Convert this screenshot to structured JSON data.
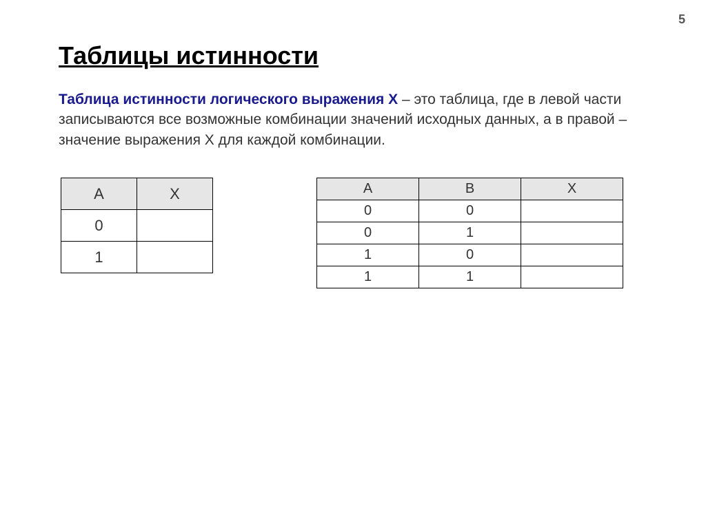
{
  "page_number": "5",
  "title": "Таблицы истинности",
  "description": {
    "term": "Таблица истинности логического выражения Х",
    "rest": " – это таблица, где в левой части записываются все возможные комбинации значений исходных данных, а в правой – значение выражения Х для каждой комбинации."
  },
  "table1": {
    "headers": [
      "A",
      "X"
    ],
    "rows": [
      [
        "0",
        ""
      ],
      [
        "1",
        ""
      ]
    ]
  },
  "table2": {
    "headers": [
      "A",
      "B",
      "X"
    ],
    "rows": [
      [
        "0",
        "0",
        ""
      ],
      [
        "0",
        "1",
        ""
      ],
      [
        "1",
        "0",
        ""
      ],
      [
        "1",
        "1",
        ""
      ]
    ]
  }
}
